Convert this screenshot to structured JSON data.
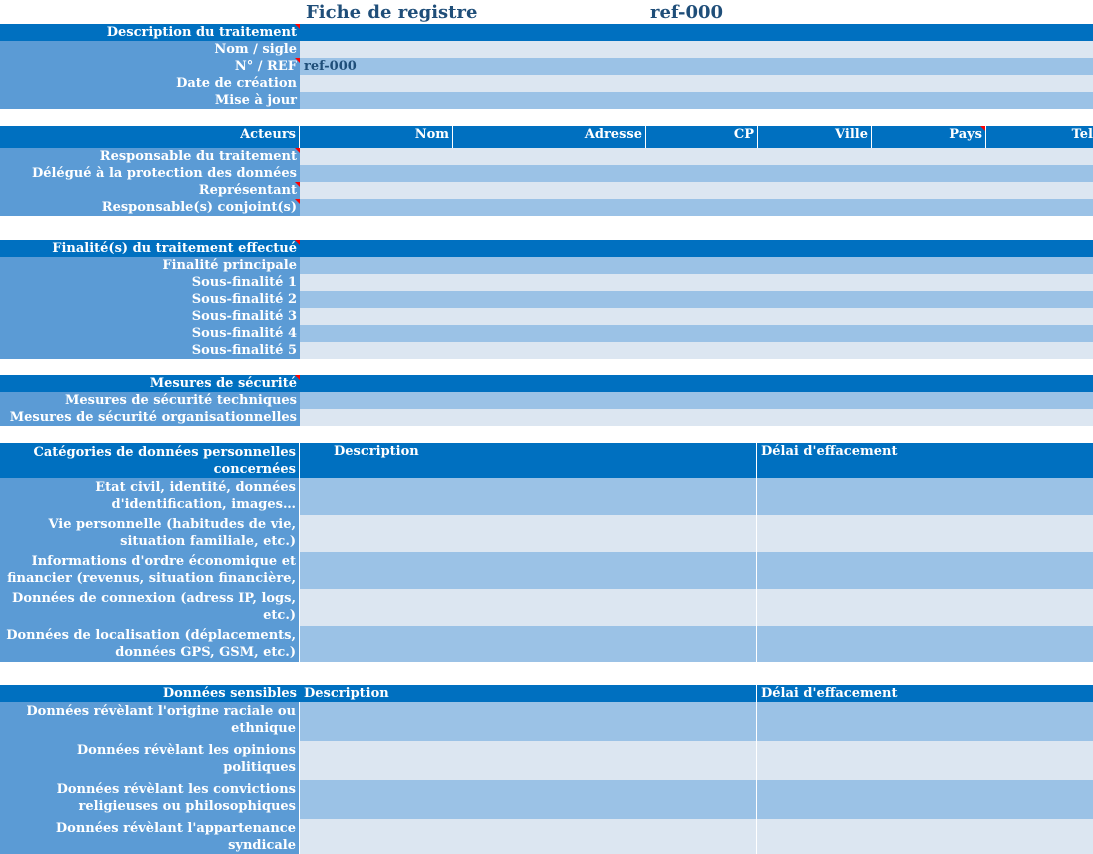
{
  "header": {
    "title": "Fiche de registre",
    "ref": "ref-000"
  },
  "description": {
    "title": "Description  du traitement",
    "rows": [
      "Nom / sigle",
      "N° / REF",
      "Date de création",
      "Mise à jour"
    ],
    "ref_value": "ref-000"
  },
  "acteurs": {
    "title": "Acteurs",
    "columns": [
      "Nom",
      "Adresse",
      "CP",
      "Ville",
      "Pays",
      "Tel"
    ],
    "rows": [
      "Responsable du traitement",
      "Délégué à la protection des données",
      "Représentant",
      "Responsable(s) conjoint(s)"
    ]
  },
  "finalites": {
    "title": "Finalité(s) du traitement effectué",
    "rows": [
      "Finalité principale",
      "Sous-finalité 1",
      "Sous-finalité 2",
      "Sous-finalité 3",
      "Sous-finalité 4",
      "Sous-finalité 5"
    ]
  },
  "securite": {
    "title": "Mesures de sécurité",
    "rows": [
      "Mesures de sécurité techniques",
      "Mesures de sécurité organisationnelles"
    ]
  },
  "categories": {
    "title": "Catégories de données personnelles concernées",
    "col_description": "Description",
    "col_delai": "Délai d'effacement",
    "rows": [
      "Etat civil, identité, données d'identification, images…",
      "Vie personnelle (habitudes de vie, situation familiale, etc.)",
      "Informations d'ordre économique et financier (revenus, situation financière,",
      "Données de connexion (adress IP, logs, etc.)",
      "Données de localisation (déplacements, données GPS, GSM, etc.)"
    ]
  },
  "sensibles": {
    "title": "Données sensibles",
    "col_description": "Description",
    "col_delai": "Délai d'effacement",
    "rows": [
      "Données révèlant l'origine raciale ou ethnique",
      "Données révèlant les opinions politiques",
      "Données révèlant les convictions religieuses ou philosophiques",
      "Données révèlant l'appartenance syndicale"
    ]
  }
}
